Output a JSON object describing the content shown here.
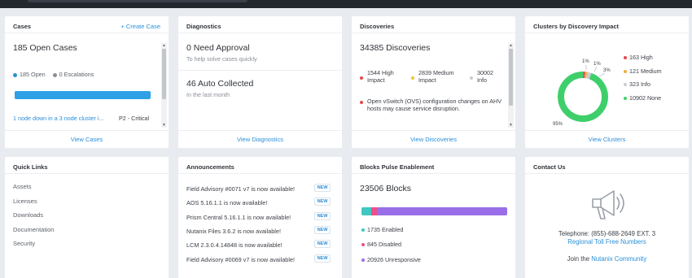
{
  "cases": {
    "title": "Cases",
    "create_link": "+ Create Case",
    "open_count": "185 Open Cases",
    "legend_open": "185 Open",
    "legend_escalations": "0 Escalations",
    "case_row_text": "1 node down in a 3 node cluster i...",
    "case_row_priority": "P2 - Critical",
    "footer": "View Cases"
  },
  "diagnostics": {
    "title": "Diagnostics",
    "approval": "0 Need Approval",
    "approval_sub": "To help solve cases quickly",
    "auto": "46 Auto Collected",
    "auto_sub": "In the last month",
    "footer": "View Diagnostics"
  },
  "discoveries": {
    "title": "Discoveries",
    "count": "34385 Discoveries",
    "high": "1544 High Impact",
    "medium": "2839 Medium Impact",
    "info": "30002 Info",
    "item_text": "Open vSwitch (OVS) configuration changes on AHV hosts may cause service disruption.",
    "footer": "View Discoveries",
    "colors": {
      "high": "#e5484d",
      "medium": "#f2c230",
      "info": "#c9ccd1"
    }
  },
  "clusters": {
    "title": "Clusters by Discovery Impact",
    "footer": "View Clusters",
    "legend": [
      {
        "label": "163 High",
        "color": "#e5484d"
      },
      {
        "label": "121 Medium",
        "color": "#f2a93b"
      },
      {
        "label": "323 Info",
        "color": "#c9ccd1"
      },
      {
        "label": "10902 None",
        "color": "#3ecf6b"
      }
    ],
    "pct_high": "1%",
    "pct_medium": "1%",
    "pct_info": "3%",
    "pct_none": "95%",
    "chart_values": [
      163,
      121,
      323,
      10902
    ]
  },
  "quick_links": {
    "title": "Quick Links",
    "items": [
      "Assets",
      "Licenses",
      "Downloads",
      "Documentation",
      "Security"
    ]
  },
  "announcements": {
    "title": "Announcements",
    "badge": "NEW",
    "items": [
      "Field Advisory #0071 v7 is now available!",
      "AOS 5.16.1.1 is now available!",
      "Prism Central 5.16.1.1 is now available!",
      "Nutanix Files 3.6.2 is now available!",
      "LCM 2.3.0.4.14848 is now available!",
      "Field Advisory #0069 v7 is now available!"
    ]
  },
  "blocks": {
    "title": "Blocks Pulse Enablement",
    "count": "23506 Blocks",
    "enabled": "1735 Enabled",
    "disabled": "845 Disabled",
    "unresponsive": "20926 Unresponsive",
    "values": [
      1735,
      845,
      20926
    ],
    "colors": {
      "enabled": "#3fc7c2",
      "disabled": "#ee4e8b",
      "unresponsive": "#9a6ee8"
    }
  },
  "contact": {
    "title": "Contact Us",
    "phone": "Telephone: (855)-688-2649 EXT. 3",
    "regional": "Regional Toll Free Numbers",
    "join_prefix": "Join the",
    "community": "Nutanix Community"
  },
  "colors": {
    "accent": "#2a8fd8",
    "open_dot": "#2a8fd8",
    "escalation_dot": "#8a8f97"
  }
}
